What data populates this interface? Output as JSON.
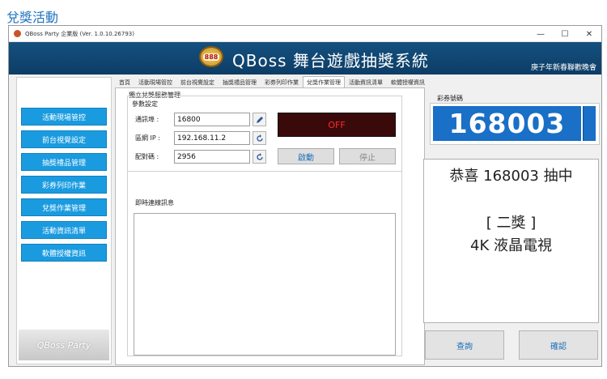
{
  "page": {
    "heading": "兌獎活動"
  },
  "window": {
    "title": "QBoss Party 企業版 (Ver. 1.0.10.26793)",
    "controls": {
      "minimize": "—",
      "maximize": "☐",
      "close": "✕"
    }
  },
  "banner": {
    "logo_text": "888",
    "title": "QBoss 舞台遊戲抽獎系統",
    "subtitle": "庚子年新春聯歡晚會"
  },
  "sidebar": {
    "items": [
      {
        "label": "活動現場管控"
      },
      {
        "label": "前台視覺設定"
      },
      {
        "label": "抽獎禮品管理"
      },
      {
        "label": "彩券列印作業"
      },
      {
        "label": "兌獎作業管理"
      },
      {
        "label": "活動資訊清單"
      },
      {
        "label": "軟體授權資訊"
      }
    ],
    "logo": "QBoss Party"
  },
  "tabs": [
    {
      "label": "首頁"
    },
    {
      "label": "活動現場管控"
    },
    {
      "label": "前台視覺設定"
    },
    {
      "label": "抽獎禮品管理"
    },
    {
      "label": "彩券列印作業"
    },
    {
      "label": "兌獎作業管理",
      "active": true
    },
    {
      "label": "活動資訊清單"
    },
    {
      "label": "軟體授權資訊"
    }
  ],
  "service": {
    "group_title": "獨立兌獎服務管理",
    "params_title": "參數設定",
    "port_label": "通訊埠 :",
    "port_value": "16800",
    "ip_label": "區網 IP :",
    "ip_value": "192.168.11.2",
    "pair_label": "配對碼 :",
    "pair_value": "2956",
    "status": "OFF",
    "start_label": "啟動",
    "stop_label": "停止",
    "log_title": "即時連線訊息"
  },
  "ticket": {
    "label": "彩券號碼",
    "number": "168003"
  },
  "result": {
    "line1": "恭喜 168003 抽中",
    "line2": "[ 二獎 ]",
    "line3": "4K 液晶電視"
  },
  "actions": {
    "query_label": "查詢",
    "confirm_label": "確認"
  },
  "colors": {
    "accent_blue": "#1a9be0",
    "banner": "#14507f",
    "ticket_bg": "#1a6fc6",
    "off_text": "#ff2a2a"
  }
}
